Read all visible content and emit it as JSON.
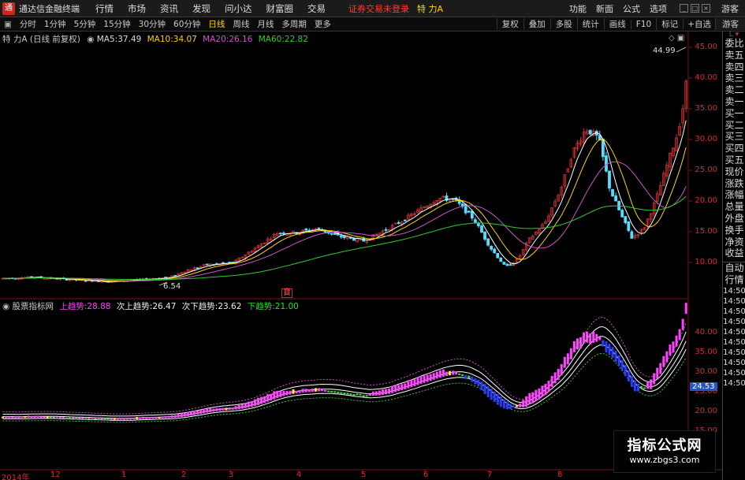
{
  "menubar": {
    "app_title": "通达信金融终端",
    "logo_glyph": "通",
    "items": [
      "行情",
      "市场",
      "资讯",
      "发现",
      "问小达",
      "财富圈",
      "交易"
    ],
    "warning": "证券交易未登录",
    "stock_name": "特 力A",
    "right_items": [
      "功能",
      "新面",
      "公式",
      "选项"
    ],
    "guest": "游客"
  },
  "periodbar": {
    "periods": [
      "分时",
      "1分钟",
      "5分钟",
      "15分钟",
      "30分钟",
      "60分钟",
      "日线",
      "周线",
      "月线",
      "多周期",
      "更多"
    ],
    "active_period": "日线",
    "tools": [
      "复权",
      "叠加",
      "多股",
      "统计",
      "画线",
      "F10",
      "标记"
    ],
    "self_select": "+自选",
    "guest": "游客"
  },
  "main_chart": {
    "title": "特 力A (日线 前复权)",
    "ma": [
      {
        "label": "MA5:",
        "value": "37.49",
        "color": "#ffffff"
      },
      {
        "label": "MA10:",
        "value": "34.07",
        "color": "#ffd400"
      },
      {
        "label": "MA20:",
        "value": "26.16",
        "color": "#cc55cc"
      },
      {
        "label": "MA60:",
        "value": "22.82",
        "color": "#33cc33"
      }
    ],
    "price_ticks": [
      "45.00",
      "40.00",
      "35.00",
      "30.00",
      "25.00",
      "20.00",
      "15.00",
      "10.00"
    ],
    "high_label": "44.99",
    "low_label": "6.54",
    "marker": "寶"
  },
  "indicator": {
    "name": "股票指标网",
    "lines": [
      {
        "label": "上趋势:",
        "value": "28.88",
        "color": "#ff44ff"
      },
      {
        "label": "次上趋势:",
        "value": "26.47",
        "color": "#ffffff"
      },
      {
        "label": "次下趋势:",
        "value": "23.62",
        "color": "#ffffff"
      },
      {
        "label": "下趋势:",
        "value": "21.00",
        "color": "#33dd33"
      }
    ],
    "ticks": [
      "40.00",
      "35.00",
      "30.00",
      "25.00",
      "20.00",
      "15.00"
    ],
    "current_value": "24.53"
  },
  "time_axis": [
    "2014年",
    "12",
    "1",
    "2",
    "3",
    "4",
    "5",
    "6",
    "7",
    "8"
  ],
  "side_panel": {
    "items": [
      "委比",
      "卖五",
      "卖四",
      "卖三",
      "卖二",
      "卖一",
      "买一",
      "买二",
      "买三",
      "买四",
      "买五",
      "现价",
      "涨跌",
      "涨幅",
      "总量",
      "外盘",
      "换手",
      "净资",
      "收益"
    ],
    "lower_items": [
      "自动",
      "行情",
      "14:50",
      "14:50",
      "14:50",
      "14:50",
      "14:50",
      "14:50",
      "14:50",
      "14:50",
      "14:50",
      "14:50"
    ]
  },
  "watermark": {
    "title": "指标公式网",
    "url": "www.zbgs3.com"
  },
  "colors": {
    "up": "#cc3333",
    "down": "#55ddff",
    "grid": "#7a1515",
    "accent": "#ffd400"
  }
}
